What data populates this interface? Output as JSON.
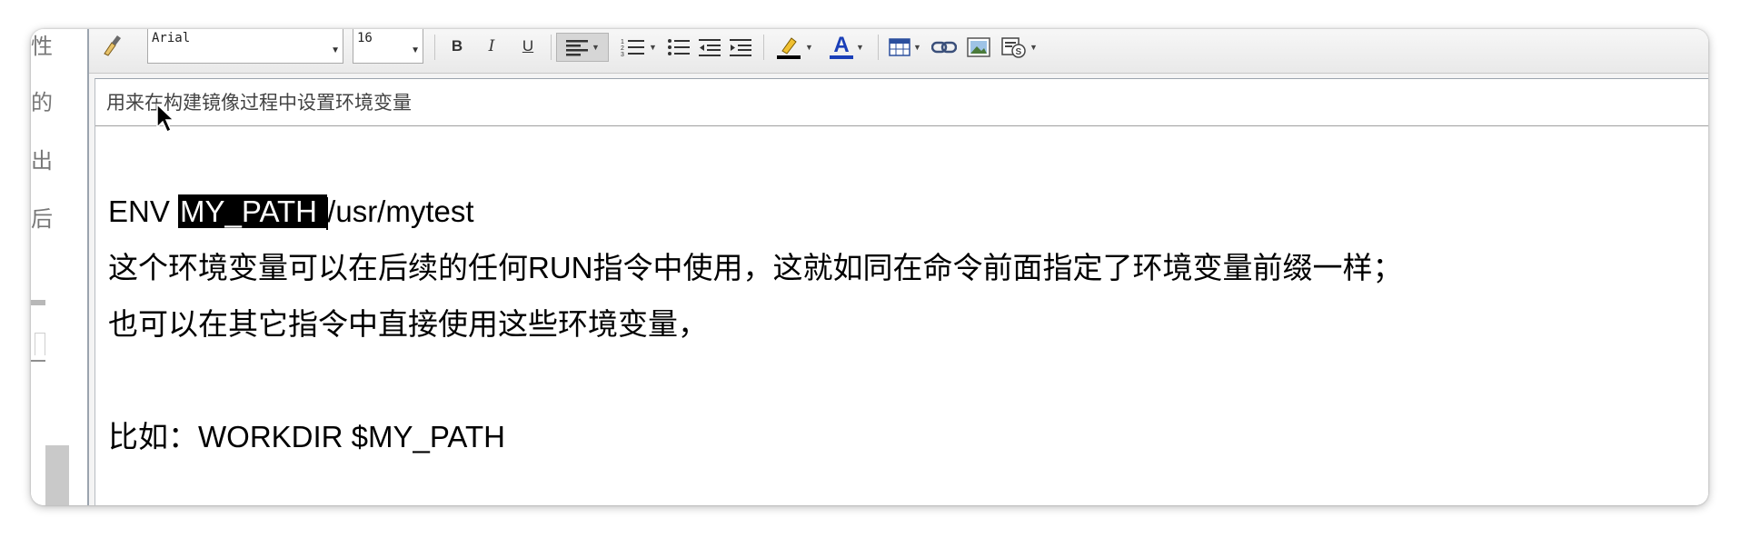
{
  "toolbar": {
    "font_family": "Arial",
    "font_size": "16",
    "bold_label": "B",
    "italic_label": "I",
    "underline_label": "U",
    "font_color_label": "A",
    "highlight_color": "#000000",
    "font_color": "#1a3fb8"
  },
  "sidebar_chars": [
    "性",
    "的",
    "出",
    "后"
  ],
  "document": {
    "title": "用来在构建镜像过程中设置环境变量",
    "line1_prefix": "ENV ",
    "line1_selected": "MY_PATH ",
    "line1_rest": "/usr/mytest",
    "line2": "这个环境变量可以在后续的任何RUN指令中使用，这就如同在命令前面指定了环境变量前缀一样；",
    "line3": "也可以在其它指令中直接使用这些环境变量，",
    "line4": "比如：WORKDIR $MY_PATH"
  }
}
